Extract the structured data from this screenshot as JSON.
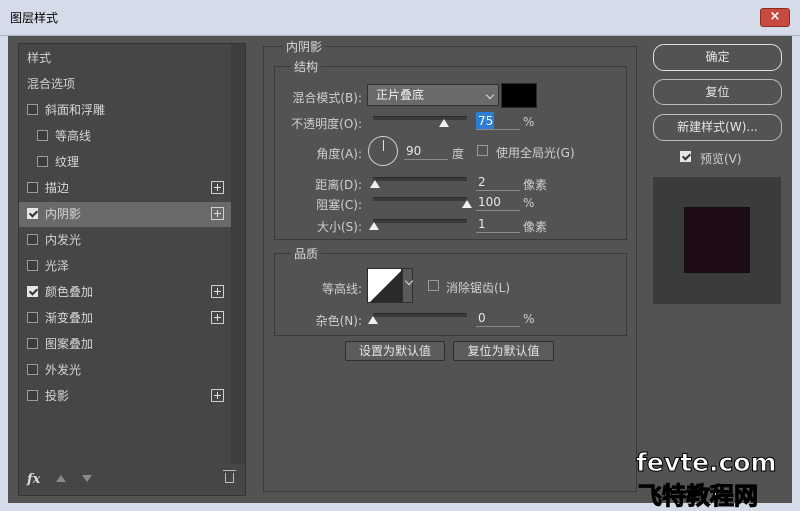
{
  "window": {
    "title": "图层样式",
    "close_glyph": "×"
  },
  "styles_panel": {
    "items": [
      {
        "label": "样式",
        "checkbox": false,
        "checked": false,
        "plus": false,
        "selected": false,
        "indent": 0
      },
      {
        "label": "混合选项",
        "checkbox": false,
        "checked": false,
        "plus": false,
        "selected": false,
        "indent": 0
      },
      {
        "label": "斜面和浮雕",
        "checkbox": true,
        "checked": false,
        "plus": false,
        "selected": false,
        "indent": 0
      },
      {
        "label": "等高线",
        "checkbox": true,
        "checked": false,
        "plus": false,
        "selected": false,
        "indent": 1
      },
      {
        "label": "纹理",
        "checkbox": true,
        "checked": false,
        "plus": false,
        "selected": false,
        "indent": 1
      },
      {
        "label": "描边",
        "checkbox": true,
        "checked": false,
        "plus": true,
        "selected": false,
        "indent": 0
      },
      {
        "label": "内阴影",
        "checkbox": true,
        "checked": true,
        "plus": true,
        "selected": true,
        "indent": 0
      },
      {
        "label": "内发光",
        "checkbox": true,
        "checked": false,
        "plus": false,
        "selected": false,
        "indent": 0
      },
      {
        "label": "光泽",
        "checkbox": true,
        "checked": false,
        "plus": false,
        "selected": false,
        "indent": 0
      },
      {
        "label": "颜色叠加",
        "checkbox": true,
        "checked": true,
        "plus": true,
        "selected": false,
        "indent": 0
      },
      {
        "label": "渐变叠加",
        "checkbox": true,
        "checked": false,
        "plus": true,
        "selected": false,
        "indent": 0
      },
      {
        "label": "图案叠加",
        "checkbox": true,
        "checked": false,
        "plus": false,
        "selected": false,
        "indent": 0
      },
      {
        "label": "外发光",
        "checkbox": true,
        "checked": false,
        "plus": false,
        "selected": false,
        "indent": 0
      },
      {
        "label": "投影",
        "checkbox": true,
        "checked": false,
        "plus": true,
        "selected": false,
        "indent": 0
      }
    ],
    "fx_label": "fx"
  },
  "inner_shadow": {
    "section_title": "内阴影",
    "structure": {
      "title": "结构",
      "blend_mode_label": "混合模式(B):",
      "blend_mode_value": "正片叠底",
      "shadow_color": "#000000",
      "opacity_label": "不透明度(O):",
      "opacity_value": "75",
      "opacity_fraction": 0.75,
      "percent": "%",
      "angle_label": "角度(A):",
      "angle_value": "90",
      "degree_unit": "度",
      "global_light_label": "使用全局光(G)",
      "global_light_checked": false,
      "distance_label": "距离(D):",
      "distance_value": "2",
      "distance_fraction": 0.02,
      "pixel_unit": "像素",
      "choke_label": "阻塞(C):",
      "choke_value": "100",
      "choke_fraction": 1.0,
      "size_label": "大小(S):",
      "size_value": "1",
      "size_fraction": 0.01
    },
    "quality": {
      "title": "品质",
      "contour_label": "等高线:",
      "antialias_label": "消除锯齿(L)",
      "antialias_checked": false,
      "noise_label": "杂色(N):",
      "noise_value": "0",
      "noise_fraction": 0.0
    },
    "set_default_label": "设置为默认值",
    "reset_default_label": "复位为默认值"
  },
  "actions": {
    "ok_label": "确定",
    "reset_label": "复位",
    "new_style_label": "新建样式(W)...",
    "preview_label": "预览(V)",
    "preview_checked": true
  },
  "watermark": {
    "line1": "fevte.com",
    "line2": "飞特教程网"
  }
}
